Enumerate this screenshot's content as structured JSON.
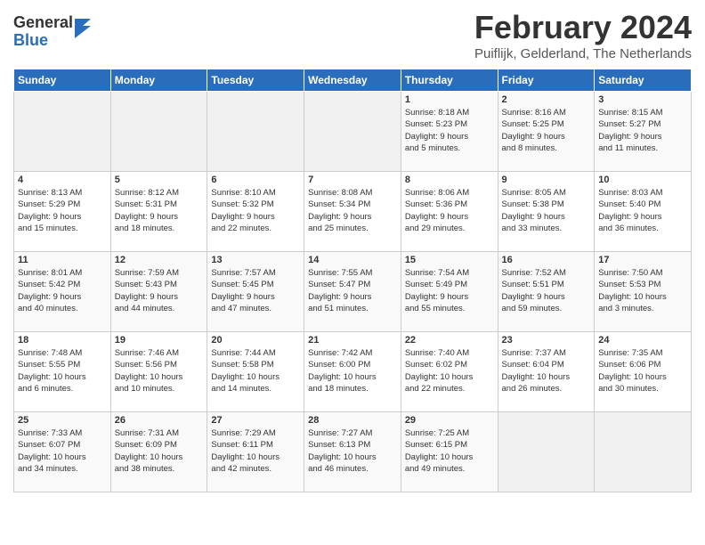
{
  "logo": {
    "general": "General",
    "blue": "Blue"
  },
  "title": "February 2024",
  "location": "Puiflijk, Gelderland, The Netherlands",
  "days_header": [
    "Sunday",
    "Monday",
    "Tuesday",
    "Wednesday",
    "Thursday",
    "Friday",
    "Saturday"
  ],
  "weeks": [
    [
      {
        "day": "",
        "info": ""
      },
      {
        "day": "",
        "info": ""
      },
      {
        "day": "",
        "info": ""
      },
      {
        "day": "",
        "info": ""
      },
      {
        "day": "1",
        "info": "Sunrise: 8:18 AM\nSunset: 5:23 PM\nDaylight: 9 hours\nand 5 minutes."
      },
      {
        "day": "2",
        "info": "Sunrise: 8:16 AM\nSunset: 5:25 PM\nDaylight: 9 hours\nand 8 minutes."
      },
      {
        "day": "3",
        "info": "Sunrise: 8:15 AM\nSunset: 5:27 PM\nDaylight: 9 hours\nand 11 minutes."
      }
    ],
    [
      {
        "day": "4",
        "info": "Sunrise: 8:13 AM\nSunset: 5:29 PM\nDaylight: 9 hours\nand 15 minutes."
      },
      {
        "day": "5",
        "info": "Sunrise: 8:12 AM\nSunset: 5:31 PM\nDaylight: 9 hours\nand 18 minutes."
      },
      {
        "day": "6",
        "info": "Sunrise: 8:10 AM\nSunset: 5:32 PM\nDaylight: 9 hours\nand 22 minutes."
      },
      {
        "day": "7",
        "info": "Sunrise: 8:08 AM\nSunset: 5:34 PM\nDaylight: 9 hours\nand 25 minutes."
      },
      {
        "day": "8",
        "info": "Sunrise: 8:06 AM\nSunset: 5:36 PM\nDaylight: 9 hours\nand 29 minutes."
      },
      {
        "day": "9",
        "info": "Sunrise: 8:05 AM\nSunset: 5:38 PM\nDaylight: 9 hours\nand 33 minutes."
      },
      {
        "day": "10",
        "info": "Sunrise: 8:03 AM\nSunset: 5:40 PM\nDaylight: 9 hours\nand 36 minutes."
      }
    ],
    [
      {
        "day": "11",
        "info": "Sunrise: 8:01 AM\nSunset: 5:42 PM\nDaylight: 9 hours\nand 40 minutes."
      },
      {
        "day": "12",
        "info": "Sunrise: 7:59 AM\nSunset: 5:43 PM\nDaylight: 9 hours\nand 44 minutes."
      },
      {
        "day": "13",
        "info": "Sunrise: 7:57 AM\nSunset: 5:45 PM\nDaylight: 9 hours\nand 47 minutes."
      },
      {
        "day": "14",
        "info": "Sunrise: 7:55 AM\nSunset: 5:47 PM\nDaylight: 9 hours\nand 51 minutes."
      },
      {
        "day": "15",
        "info": "Sunrise: 7:54 AM\nSunset: 5:49 PM\nDaylight: 9 hours\nand 55 minutes."
      },
      {
        "day": "16",
        "info": "Sunrise: 7:52 AM\nSunset: 5:51 PM\nDaylight: 9 hours\nand 59 minutes."
      },
      {
        "day": "17",
        "info": "Sunrise: 7:50 AM\nSunset: 5:53 PM\nDaylight: 10 hours\nand 3 minutes."
      }
    ],
    [
      {
        "day": "18",
        "info": "Sunrise: 7:48 AM\nSunset: 5:55 PM\nDaylight: 10 hours\nand 6 minutes."
      },
      {
        "day": "19",
        "info": "Sunrise: 7:46 AM\nSunset: 5:56 PM\nDaylight: 10 hours\nand 10 minutes."
      },
      {
        "day": "20",
        "info": "Sunrise: 7:44 AM\nSunset: 5:58 PM\nDaylight: 10 hours\nand 14 minutes."
      },
      {
        "day": "21",
        "info": "Sunrise: 7:42 AM\nSunset: 6:00 PM\nDaylight: 10 hours\nand 18 minutes."
      },
      {
        "day": "22",
        "info": "Sunrise: 7:40 AM\nSunset: 6:02 PM\nDaylight: 10 hours\nand 22 minutes."
      },
      {
        "day": "23",
        "info": "Sunrise: 7:37 AM\nSunset: 6:04 PM\nDaylight: 10 hours\nand 26 minutes."
      },
      {
        "day": "24",
        "info": "Sunrise: 7:35 AM\nSunset: 6:06 PM\nDaylight: 10 hours\nand 30 minutes."
      }
    ],
    [
      {
        "day": "25",
        "info": "Sunrise: 7:33 AM\nSunset: 6:07 PM\nDaylight: 10 hours\nand 34 minutes."
      },
      {
        "day": "26",
        "info": "Sunrise: 7:31 AM\nSunset: 6:09 PM\nDaylight: 10 hours\nand 38 minutes."
      },
      {
        "day": "27",
        "info": "Sunrise: 7:29 AM\nSunset: 6:11 PM\nDaylight: 10 hours\nand 42 minutes."
      },
      {
        "day": "28",
        "info": "Sunrise: 7:27 AM\nSunset: 6:13 PM\nDaylight: 10 hours\nand 46 minutes."
      },
      {
        "day": "29",
        "info": "Sunrise: 7:25 AM\nSunset: 6:15 PM\nDaylight: 10 hours\nand 49 minutes."
      },
      {
        "day": "",
        "info": ""
      },
      {
        "day": "",
        "info": ""
      }
    ]
  ]
}
